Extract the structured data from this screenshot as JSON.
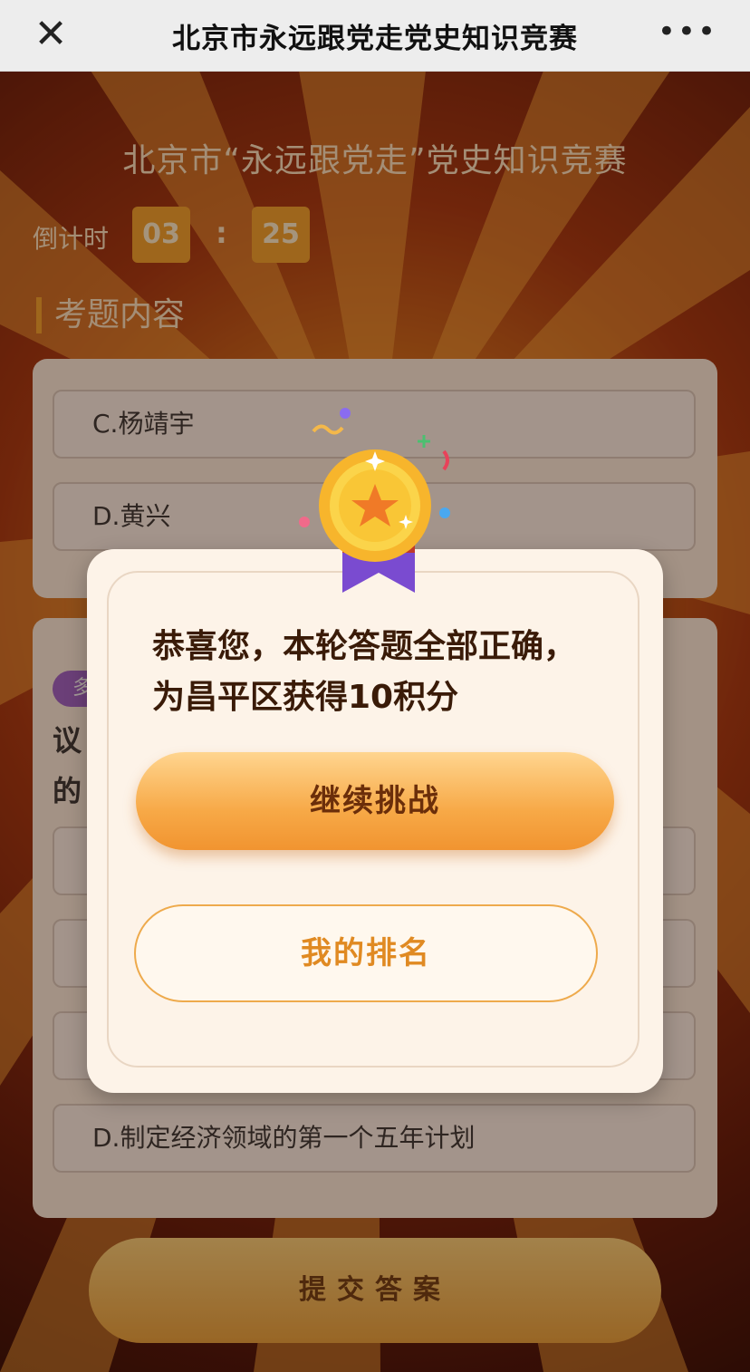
{
  "navbar": {
    "title": "北京市永远跟党走党史知识竞赛",
    "close_icon": "close-icon",
    "more_icon": "more-icon"
  },
  "header": {
    "heading": "北京市“永远跟党走”党史知识竞赛",
    "countdown_label": "倒计时",
    "minutes": "03",
    "separator": ":",
    "seconds": "25"
  },
  "section": {
    "title": "考题内容"
  },
  "question1": {
    "options": [
      {
        "label": "C.杨靖宇"
      },
      {
        "label": "D.黄兴"
      }
    ]
  },
  "question2": {
    "badge": "多",
    "text_line1": "议",
    "text_line2": "的",
    "options": [
      {
        "label": ""
      },
      {
        "label": ""
      },
      {
        "label": ""
      },
      {
        "label": "D.制定经济领域的第一个五年计划"
      }
    ]
  },
  "submit": {
    "label": "提交答案"
  },
  "modal": {
    "message_line1": "恭喜您，本轮答题全部正确，",
    "message_line2": "为昌平区获得10积分",
    "continue_label": "继续挑战",
    "rank_label": "我的排名",
    "medal_icon": "medal-icon"
  },
  "colors": {
    "accent": "#f19430",
    "text_dark": "#3a1b08",
    "ribbon": "#7a4bd0"
  }
}
